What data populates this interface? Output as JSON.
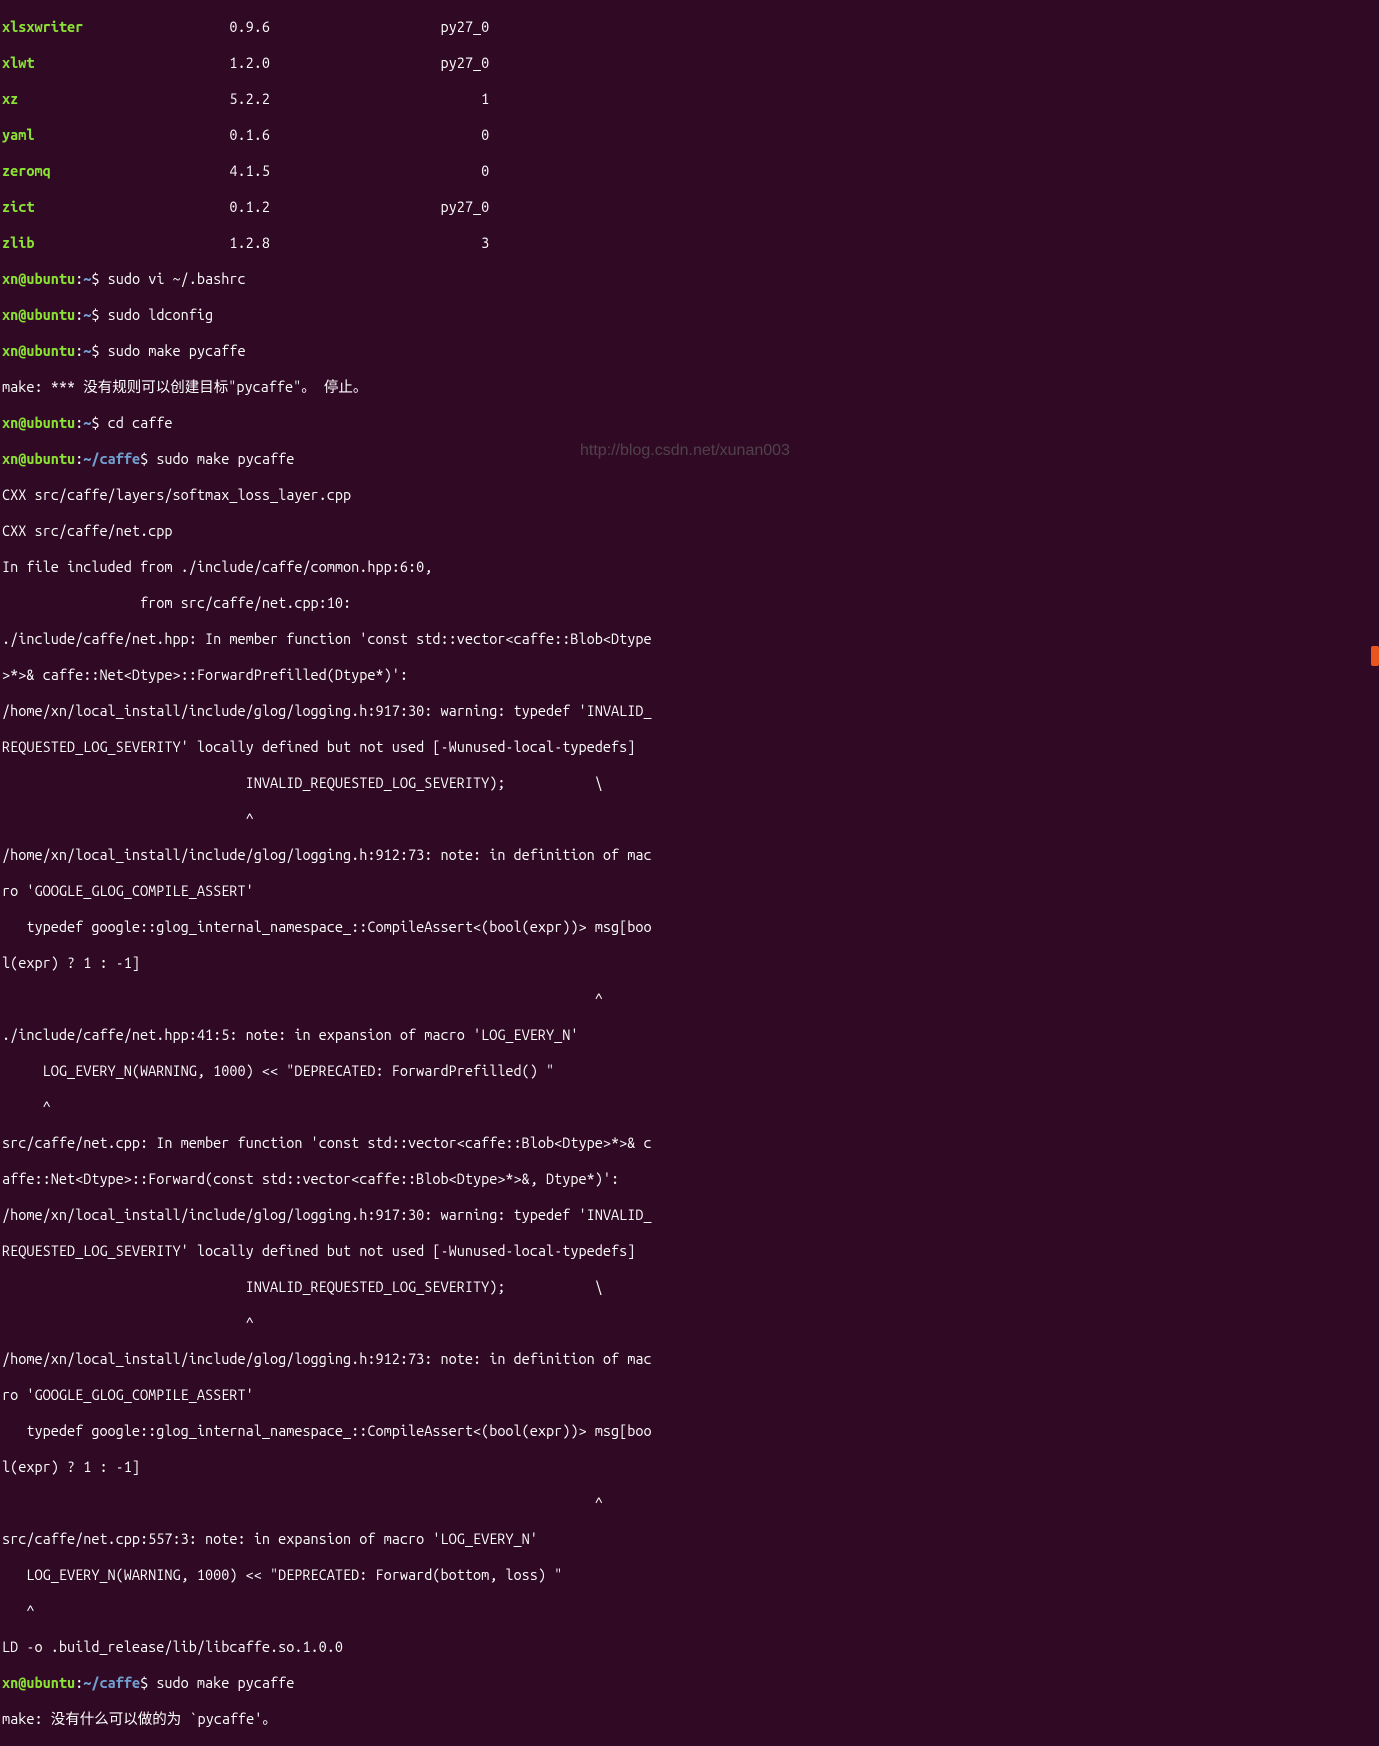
{
  "packages": [
    {
      "name": "xlsxwriter",
      "version": "0.9.6",
      "build": "py27_0"
    },
    {
      "name": "xlwt",
      "version": "1.2.0",
      "build": "py27_0"
    },
    {
      "name": "xz",
      "version": "5.2.2",
      "build": "1"
    },
    {
      "name": "yaml",
      "version": "0.1.6",
      "build": "0"
    },
    {
      "name": "zeromq",
      "version": "4.1.5",
      "build": "0"
    },
    {
      "name": "zict",
      "version": "0.1.2",
      "build": "py27_0"
    },
    {
      "name": "zlib",
      "version": "1.2.8",
      "build": "3"
    }
  ],
  "prompts": {
    "user_host1": "xn@ubuntu",
    "path_home": "~",
    "path_caffe": "~/caffe",
    "dollar": "$"
  },
  "commands": {
    "cmd1": "sudo vi ~/.bashrc",
    "cmd2": "sudo ldconfig",
    "cmd3": "sudo make pycaffe",
    "cmd4": "cd caffe",
    "cmd5": "sudo make pycaffe",
    "cmd6": "sudo make pycaffe"
  },
  "output": {
    "make_err1": "make: *** 没有规则可以创建目标\"pycaffe\"。 停止。",
    "cxx1": "CXX src/caffe/layers/softmax_loss_layer.cpp",
    "cxx2": "CXX src/caffe/net.cpp",
    "inc1": "In file included from ./include/caffe/common.hpp:6:0,",
    "inc2": "                 from src/caffe/net.cpp:10:",
    "mem1": "./include/caffe/net.hpp: In member function 'const std::vector<caffe::Blob<Dtype",
    "mem2": ">*>& caffe::Net<Dtype>::ForwardPrefilled(Dtype*)':",
    "warn1": "/home/xn/local_install/include/glog/logging.h:917:30: warning: typedef 'INVALID_",
    "warn2": "REQUESTED_LOG_SEVERITY' locally defined but not used [-Wunused-local-typedefs]",
    "warn3": "                              INVALID_REQUESTED_LOG_SEVERITY);           \\",
    "caret1": "                              ^",
    "note1": "/home/xn/local_install/include/glog/logging.h:912:73: note: in definition of mac",
    "note2": "ro 'GOOGLE_GLOG_COMPILE_ASSERT'",
    "typedef1": "   typedef google::glog_internal_namespace_::CompileAssert<(bool(expr))> msg[boo",
    "typedef2": "l(expr) ? 1 : -1]",
    "caret2": "                                                                         ^",
    "exp1": "./include/caffe/net.hpp:41:5: note: in expansion of macro 'LOG_EVERY_N'",
    "exp2": "     LOG_EVERY_N(WARNING, 1000) << \"DEPRECATED: ForwardPrefilled() \"",
    "caret3": "     ^",
    "mem3": "src/caffe/net.cpp: In member function 'const std::vector<caffe::Blob<Dtype>*>& c",
    "mem4": "affe::Net<Dtype>::Forward(const std::vector<caffe::Blob<Dtype>*>&, Dtype*)':",
    "warn4": "/home/xn/local_install/include/glog/logging.h:917:30: warning: typedef 'INVALID_",
    "warn5": "REQUESTED_LOG_SEVERITY' locally defined but not used [-Wunused-local-typedefs]",
    "warn6": "                              INVALID_REQUESTED_LOG_SEVERITY);           \\",
    "caret4": "                              ^",
    "note3": "/home/xn/local_install/include/glog/logging.h:912:73: note: in definition of mac",
    "note4": "ro 'GOOGLE_GLOG_COMPILE_ASSERT'",
    "typedef3": "   typedef google::glog_internal_namespace_::CompileAssert<(bool(expr))> msg[boo",
    "typedef4": "l(expr) ? 1 : -1]",
    "caret5": "                                                                         ^",
    "exp3": "src/caffe/net.cpp:557:3: note: in expansion of macro 'LOG_EVERY_N'",
    "exp4": "   LOG_EVERY_N(WARNING, 1000) << \"DEPRECATED: Forward(bottom, loss) \"",
    "caret6": "   ^",
    "ld": "LD -o .build_release/lib/libcaffe.so.1.0.0",
    "make_done": "make: 没有什么可以做的为 `pycaffe'。"
  },
  "watermark": "http://blog.csdn.net/xunan003"
}
